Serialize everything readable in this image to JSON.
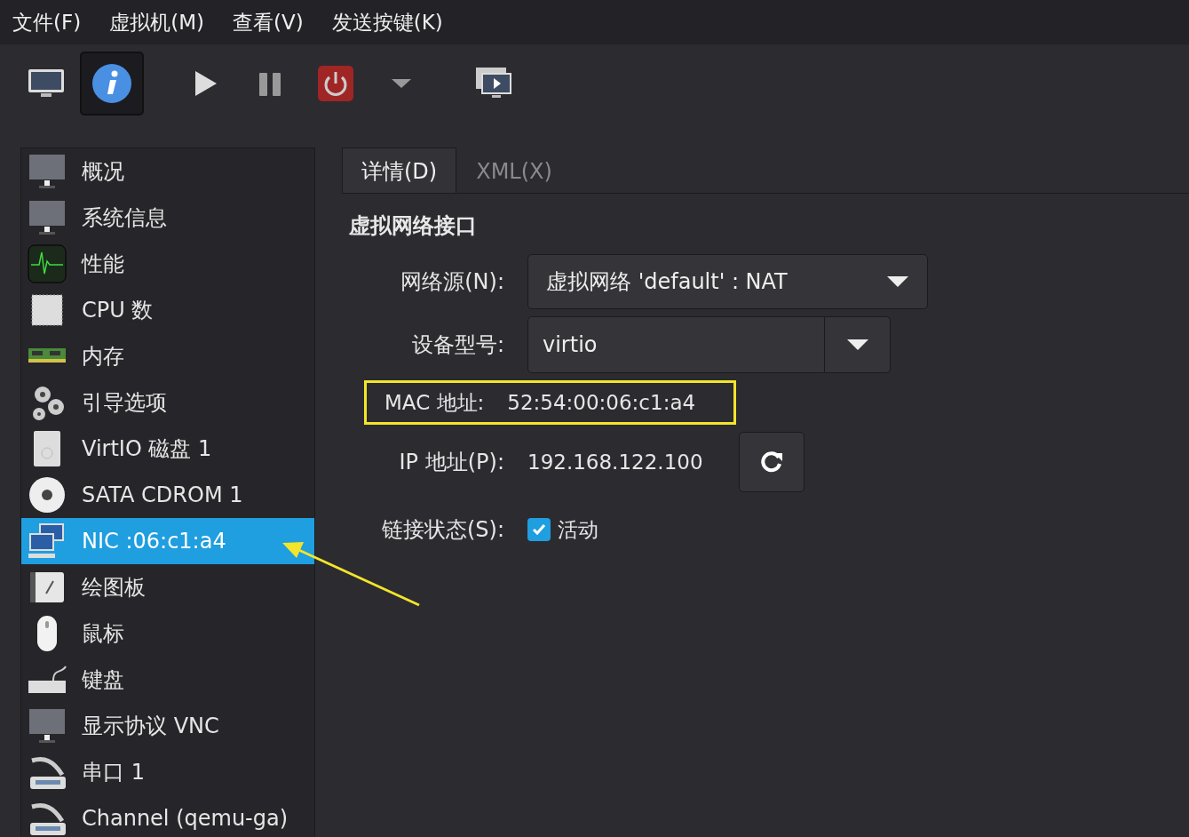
{
  "menu": [
    "文件(F)",
    "虚拟机(M)",
    "查看(V)",
    "发送按键(K)"
  ],
  "toolbar": [
    {
      "kind": "monitor",
      "selected": false
    },
    {
      "kind": "info",
      "selected": true
    },
    {
      "kind": "play",
      "selected": false
    },
    {
      "kind": "pause",
      "selected": false
    },
    {
      "kind": "power",
      "selected": false
    },
    {
      "kind": "caret",
      "selected": false
    },
    {
      "kind": "screens",
      "selected": false
    }
  ],
  "sidebar": {
    "items": [
      {
        "label": "概况",
        "kind": "monitor",
        "selected": false
      },
      {
        "label": "系统信息",
        "kind": "monitor",
        "selected": false
      },
      {
        "label": "性能",
        "kind": "graph",
        "selected": false
      },
      {
        "label": "CPU 数",
        "kind": "chip",
        "selected": false
      },
      {
        "label": "内存",
        "kind": "ram",
        "selected": false
      },
      {
        "label": "引导选项",
        "kind": "gears",
        "selected": false
      },
      {
        "label": "VirtIO 磁盘 1",
        "kind": "disk",
        "selected": false
      },
      {
        "label": "SATA CDROM 1",
        "kind": "cdrom",
        "selected": false
      },
      {
        "label": "NIC :06:c1:a4",
        "kind": "network",
        "selected": true
      },
      {
        "label": "绘图板",
        "kind": "tablet",
        "selected": false
      },
      {
        "label": "鼠标",
        "kind": "mouse",
        "selected": false
      },
      {
        "label": "键盘",
        "kind": "keyboard",
        "selected": false
      },
      {
        "label": "显示协议 VNC",
        "kind": "monitor",
        "selected": false
      },
      {
        "label": "串口 1",
        "kind": "serial",
        "selected": false
      },
      {
        "label": "Channel (qemu-ga)",
        "kind": "serial",
        "selected": false
      }
    ]
  },
  "tabs": [
    {
      "label": "详情(D)",
      "selected": true
    },
    {
      "label": "XML(X)",
      "selected": false
    }
  ],
  "section_title": "虚拟网络接口",
  "network_source": {
    "label": "网络源(N):",
    "value": "虚拟网络 'default' : NAT"
  },
  "device_model": {
    "label": "设备型号:",
    "value": "virtio"
  },
  "mac": {
    "label": "MAC 地址:",
    "value": "52:54:00:06:c1:a4"
  },
  "ip": {
    "label": "IP 地址(P):",
    "value": "192.168.122.100"
  },
  "link_state": {
    "label": "链接状态(S):",
    "text": "活动",
    "checked": true
  }
}
